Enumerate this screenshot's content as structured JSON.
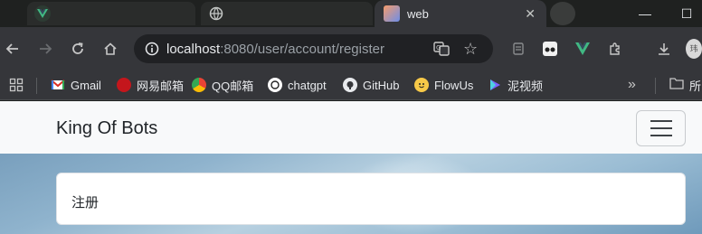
{
  "tabs": [
    {
      "title": "",
      "icon": "vue-icon"
    },
    {
      "title": "",
      "icon": "globe-icon"
    },
    {
      "title": "web",
      "icon": "web-favicon",
      "active": true
    }
  ],
  "window": {
    "minimize": "—",
    "maximize": "☐"
  },
  "toolbar": {
    "url_host": "localhost",
    "url_path": ":8080/user/account/register"
  },
  "bookmarks": [
    {
      "label": "Gmail",
      "icon": "gmail-icon",
      "color": "#d93025"
    },
    {
      "label": "网易邮箱",
      "icon": "netease-mail-icon",
      "color": "#c4161c"
    },
    {
      "label": "QQ邮箱",
      "icon": "qq-mail-icon",
      "color": "#1aad19"
    },
    {
      "label": "chatgpt",
      "icon": "chatgpt-icon",
      "color": "#ffffff"
    },
    {
      "label": "GitHub",
      "icon": "github-icon",
      "color": "#ffffff"
    },
    {
      "label": "FlowUs",
      "icon": "flowus-icon",
      "color": "#f7c948"
    },
    {
      "label": "泥视频",
      "icon": "video-icon",
      "color": "#7b61ff"
    }
  ],
  "bookmarks_overflow": "»",
  "bookmarks_folder": "所",
  "navbar": {
    "brand": "King Of Bots"
  },
  "card": {
    "header": "注册"
  }
}
